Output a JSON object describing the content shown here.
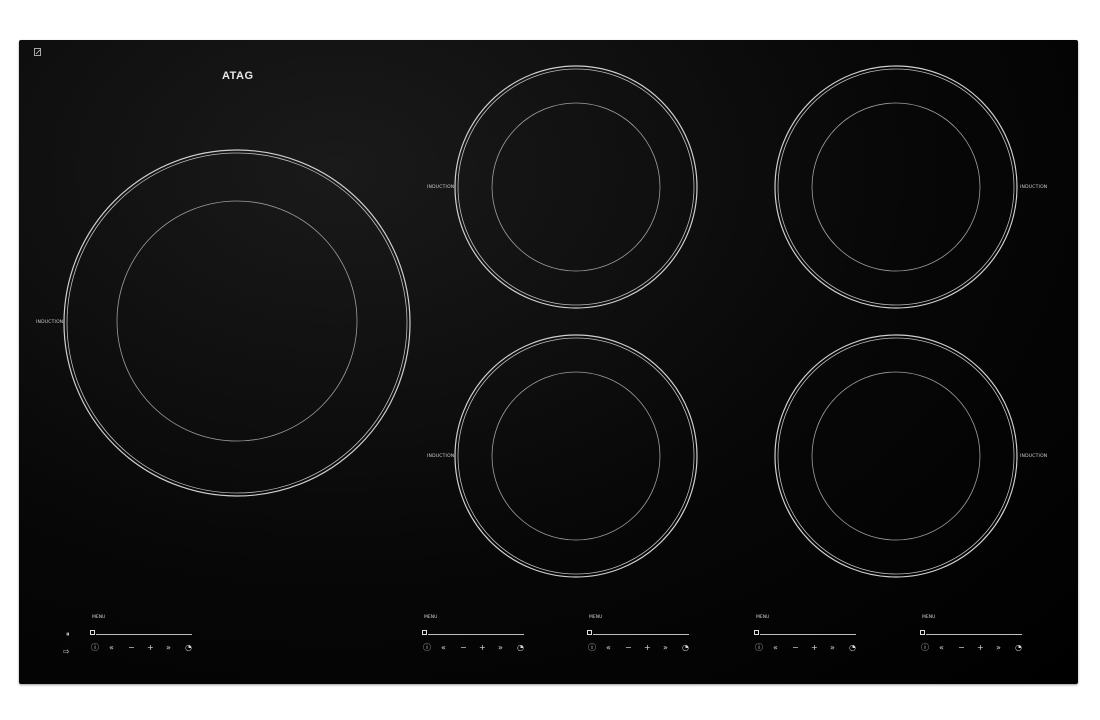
{
  "brand": "ATAG",
  "zone_label": "INDUCTION",
  "menu_label": "MENU",
  "colors": {
    "glass": "#000000",
    "print": "#d9d9d9"
  },
  "icons": {
    "power": "ⓘ",
    "fast_down": "«",
    "minus": "−",
    "plus": "+",
    "fast_up": "»",
    "timer": "◔",
    "pause": "⏸",
    "lock": "⇨"
  },
  "zones": [
    {
      "name": "large-left",
      "label": "INDUCTION"
    },
    {
      "name": "rear-center",
      "label": "INDUCTION"
    },
    {
      "name": "rear-right",
      "label": "INDUCTION"
    },
    {
      "name": "front-center",
      "label": "INDUCTION"
    },
    {
      "name": "front-right",
      "label": "INDUCTION"
    }
  ],
  "controls": [
    {
      "menu": "MENU"
    },
    {
      "menu": "MENU"
    },
    {
      "menu": "MENU"
    },
    {
      "menu": "MENU"
    },
    {
      "menu": "MENU"
    }
  ]
}
